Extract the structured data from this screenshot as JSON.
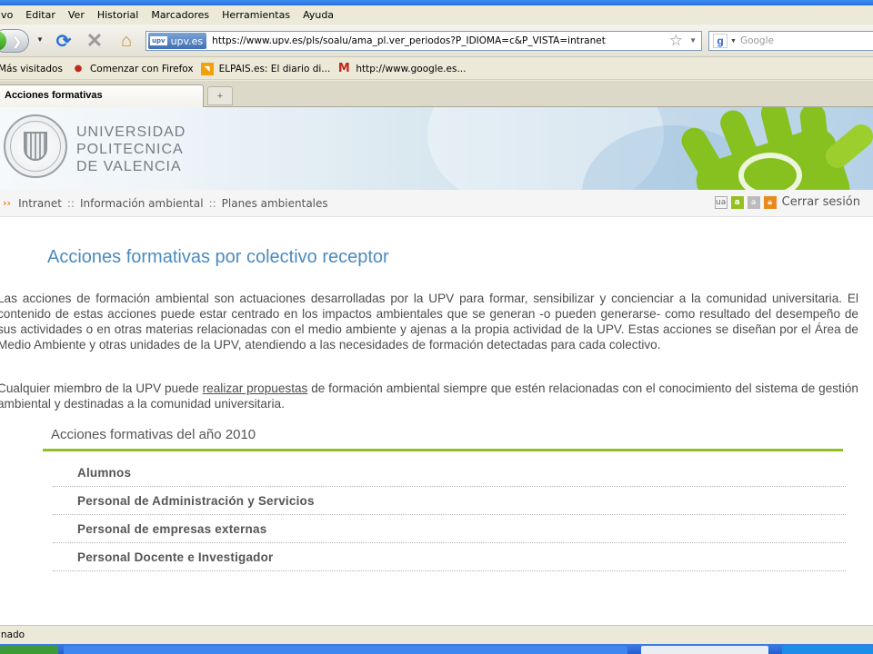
{
  "browser": {
    "menu": [
      "ivo",
      "Editar",
      "Ver",
      "Historial",
      "Marcadores",
      "Herramientas",
      "Ayuda"
    ],
    "site_badge": "upv.es",
    "site_badge_logo": "upv",
    "url": "https://www.upv.es/pls/soalu/ama_pl.ver_periodos?P_IDIOMA=c&P_VISTA=intranet",
    "search_placeholder": "Google",
    "bookmarks": [
      {
        "label": "Más visitados",
        "icon": "none"
      },
      {
        "label": "Comenzar con Firefox",
        "icon": "firefox-icon"
      },
      {
        "label": "ELPAIS.es: El diario di...",
        "icon": "rss-icon"
      },
      {
        "label": "http://www.google.es...",
        "icon": "gmail-icon"
      }
    ],
    "tab_title": "Acciones formativas",
    "new_tab_symbol": "+",
    "status_text": "inado"
  },
  "header": {
    "university_name": [
      "UNIVERSIDAD",
      "POLITECNICA",
      "DE VALENCIA"
    ],
    "accent_color": "#8dc21f",
    "title_color": "#4a8bbf"
  },
  "breadcrumb": {
    "arrows": "››",
    "items": [
      "Intranet",
      "Información ambiental",
      "Planes ambientales"
    ],
    "separator": "::"
  },
  "tools": {
    "text_size_small": "ua",
    "text_size_mid": "a",
    "text_size_large": "a",
    "logout": "Cerrar sesión"
  },
  "main": {
    "title": "Acciones formativas por colectivo receptor",
    "paragraph1": "Las acciones de formación ambiental son actuaciones desarrolladas por la UPV para formar, sensibilizar y concienciar a la comunidad universitaria. El contenido de estas acciones puede estar centrado en los impactos ambientales que se generan -o pueden generarse- como resultado del desempeño de sus actividades o en otras materias relacionadas con el medio ambiente y ajenas a la propia actividad de la UPV. Estas acciones se diseñan por el Área de Medio Ambiente y otras unidades de la UPV, atendiendo a las necesidades de formación detectadas para cada colectivo.",
    "paragraph2_before": "Cualquier miembro de la UPV puede ",
    "paragraph2_link": "realizar propuestas",
    "paragraph2_after": " de formación ambiental siempre que estén relacionadas con el conocimiento del sistema de gestión ambiental y destinadas a la comunidad universitaria.",
    "section_title": "Acciones formativas del año 2010",
    "groups": [
      "Alumnos",
      "Personal de Administración y Servicios",
      "Personal de empresas externas",
      "Personal Docente e Investigador"
    ]
  }
}
